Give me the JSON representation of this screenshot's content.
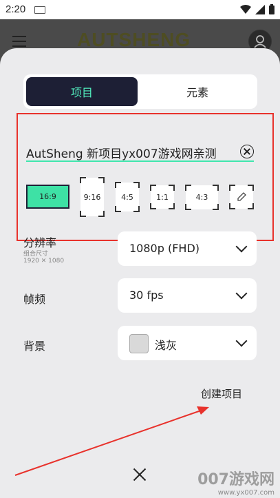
{
  "status": {
    "time": "2:20"
  },
  "app": {
    "logo": "AUTSHENG"
  },
  "tabs": [
    {
      "label": "项目",
      "active": true
    },
    {
      "label": "元素",
      "active": false
    }
  ],
  "project": {
    "name": "AutSheng 新项目yx007游戏网亲测"
  },
  "ratios": [
    "16:9",
    "9:16",
    "4:5",
    "1:1",
    "4:3"
  ],
  "selected_ratio": "16:9",
  "settings": {
    "resolution": {
      "label": "分辨率",
      "size_label": "组合尺寸",
      "size_value": "1920 ✕ 1080",
      "value": "1080p (FHD)"
    },
    "framerate": {
      "label": "帧频",
      "value": "30 fps"
    },
    "background": {
      "label": "背景",
      "value": "浅灰",
      "swatch_color": "#d9d9d9"
    }
  },
  "actions": {
    "create": "创建项目"
  },
  "watermark": {
    "main": "007游戏网",
    "url": "www.yx007.com"
  },
  "colors": {
    "accent": "#40e6ad",
    "tab_active_bg": "#1d1f35",
    "highlight_box": "#e8322c",
    "arrow": "#e8322c"
  }
}
